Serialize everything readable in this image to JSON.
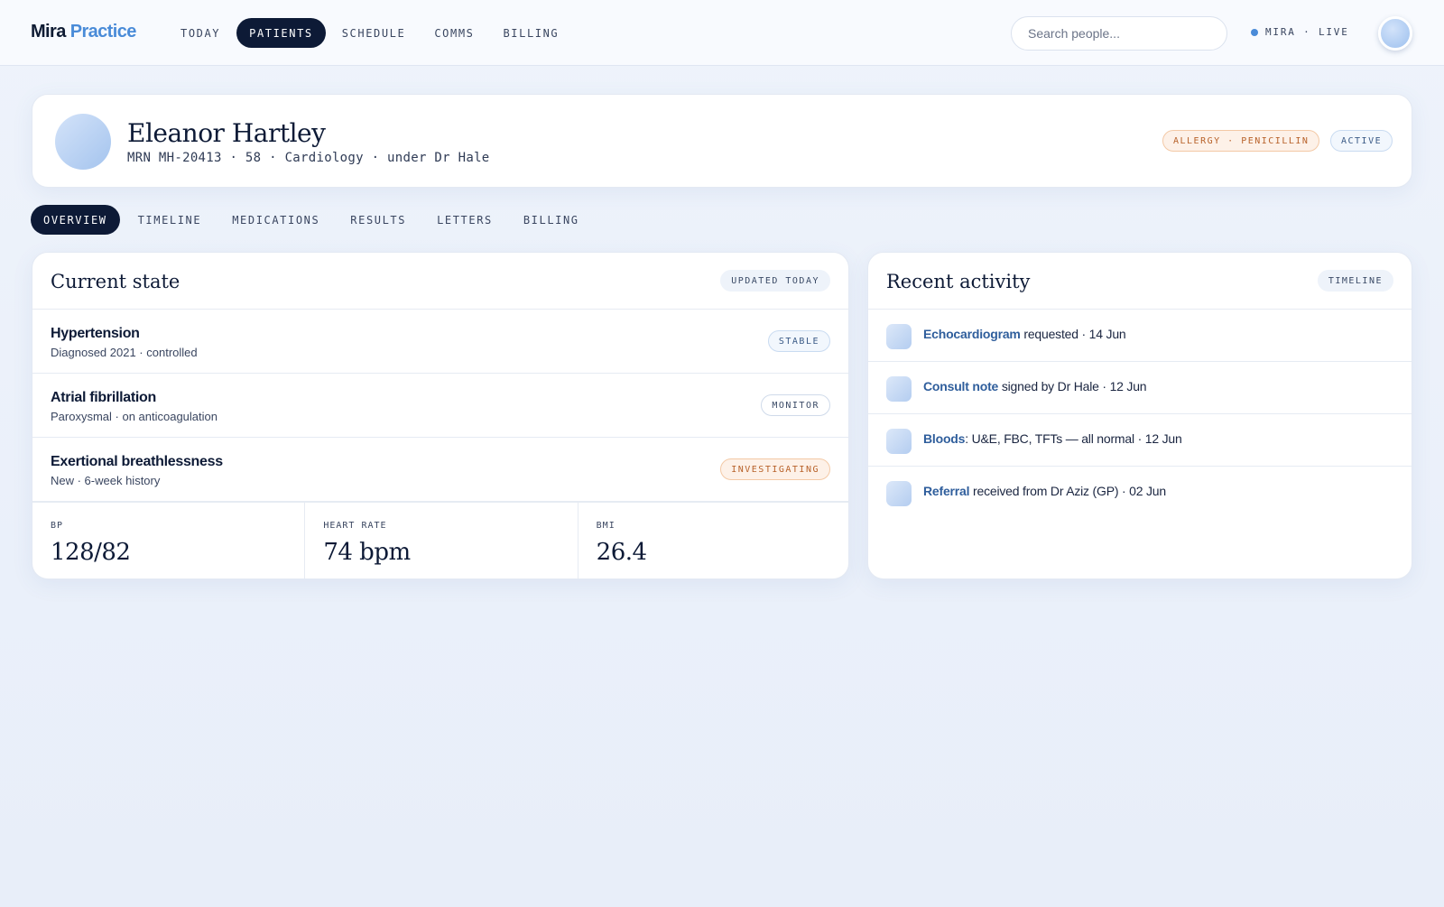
{
  "brand": {
    "name": "Mira",
    "accent": "Practice"
  },
  "nav": {
    "items": [
      {
        "label": "TODAY"
      },
      {
        "label": "PATIENTS"
      },
      {
        "label": "SCHEDULE"
      },
      {
        "label": "COMMS"
      },
      {
        "label": "BILLING"
      }
    ],
    "active": "PATIENTS"
  },
  "search": {
    "placeholder": "Search people..."
  },
  "status_indicator": {
    "label": "MIRA · LIVE"
  },
  "patient": {
    "name": "Eleanor Hartley",
    "meta": "MRN MH-20413 · 58 · Cardiology · under Dr Hale",
    "allergy_badge": "ALLERGY · PENICILLIN",
    "status_badge": "ACTIVE"
  },
  "tabs": {
    "items": [
      {
        "label": "OVERVIEW"
      },
      {
        "label": "TIMELINE"
      },
      {
        "label": "MEDICATIONS"
      },
      {
        "label": "RESULTS"
      },
      {
        "label": "LETTERS"
      },
      {
        "label": "BILLING"
      }
    ],
    "active": "OVERVIEW"
  },
  "current_state": {
    "title": "Current state",
    "badge": "UPDATED TODAY",
    "conditions": [
      {
        "name": "Hypertension",
        "detail": "Diagnosed 2021 · controlled",
        "status": "STABLE"
      },
      {
        "name": "Atrial fibrillation",
        "detail": "Paroxysmal · on anticoagulation",
        "status": "MONITOR"
      },
      {
        "name": "Exertional breathlessness",
        "detail": "New · 6-week history",
        "status": "INVESTIGATING"
      }
    ],
    "vitals": [
      {
        "label": "BP",
        "value": "128/82"
      },
      {
        "label": "HEART RATE",
        "value": "74 bpm"
      },
      {
        "label": "BMI",
        "value": "26.4"
      }
    ]
  },
  "recent_activity": {
    "title": "Recent activity",
    "badge": "TIMELINE",
    "items": [
      {
        "link": "Echocardiogram",
        "text": " requested · 14 Jun"
      },
      {
        "link": "Consult note",
        "text": " signed by Dr Hale · 12 Jun"
      },
      {
        "link": "Bloods",
        "text": ": U&E, FBC, TFTs — all normal · 12 Jun"
      },
      {
        "link": "Referral",
        "text": " received from Dr Aziz (GP) · 02 Jun"
      }
    ]
  },
  "colors": {
    "navy": "#0d1a36",
    "accent": "#4a8bd8",
    "warn": "#b8622a",
    "link": "#2f5e9c"
  }
}
